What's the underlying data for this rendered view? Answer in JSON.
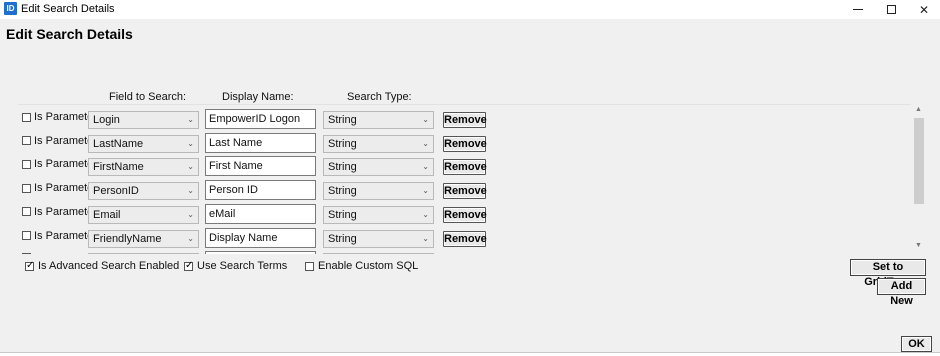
{
  "window": {
    "icon_text": "ID",
    "title": "Edit Search Details",
    "controls": {
      "minimize": "—",
      "maximize": "☐",
      "close": "✕"
    }
  },
  "page": {
    "title": "Edit Search Details"
  },
  "columns": {
    "field": "Field to Search:",
    "display": "Display Name:",
    "type": "Search Type:"
  },
  "rows": [
    {
      "param_label": "Is Parameter",
      "field": "Login",
      "display": "EmpowerID Logon",
      "type": "String",
      "remove": "Remove"
    },
    {
      "param_label": "Is Parameter",
      "field": "LastName",
      "display": "Last Name",
      "type": "String",
      "remove": "Remove"
    },
    {
      "param_label": "Is Parameter",
      "field": "FirstName",
      "display": "First Name",
      "type": "String",
      "remove": "Remove"
    },
    {
      "param_label": "Is Parameter",
      "field": "PersonID",
      "display": "Person ID",
      "type": "String",
      "remove": "Remove"
    },
    {
      "param_label": "Is Parameter",
      "field": "Email",
      "display": "eMail",
      "type": "String",
      "remove": "Remove"
    },
    {
      "param_label": "Is Parameter",
      "field": "FriendlyName",
      "display": "Display Name",
      "type": "String",
      "remove": "Remove"
    }
  ],
  "options": {
    "advanced": {
      "label": "Is Advanced Search Enabled",
      "checked": true
    },
    "search_terms": {
      "label": "Use Search Terms",
      "checked": true
    },
    "custom_sql": {
      "label": "Enable Custom SQL",
      "checked": false
    }
  },
  "buttons": {
    "set_gridtype": "Set to GridType",
    "add_new": "Add New",
    "ok": "OK"
  },
  "icons": {
    "chevron": "⌄",
    "scroll_up": "▲",
    "scroll_down": "▼"
  },
  "colors": {
    "app_icon": "#1e6fd0"
  }
}
